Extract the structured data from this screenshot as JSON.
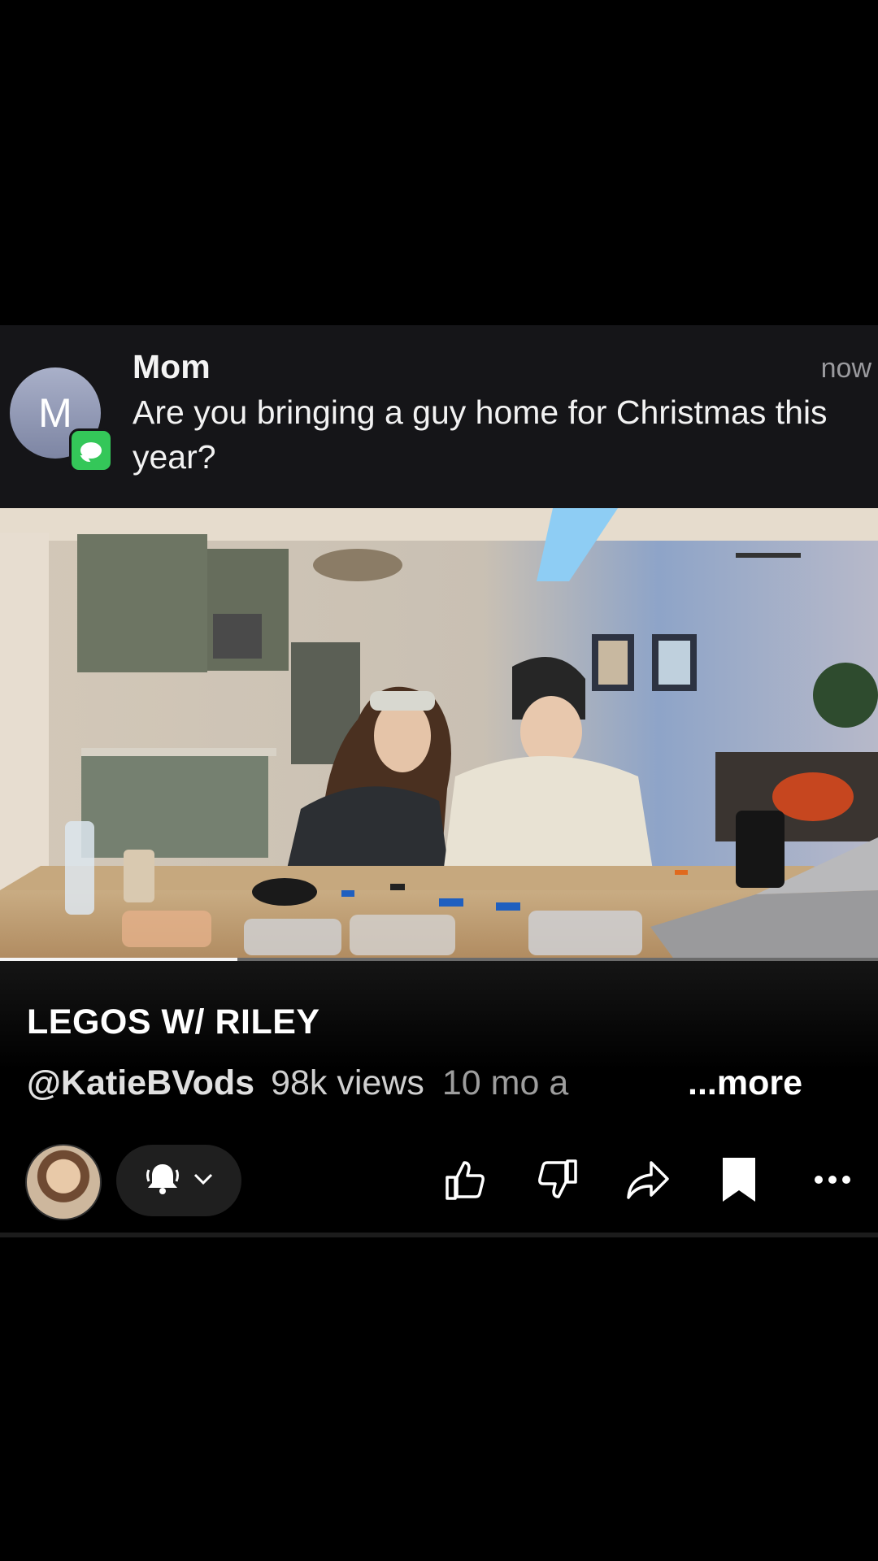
{
  "notification": {
    "avatar_initial": "M",
    "sender": "Mom",
    "time": "now",
    "message": "Are you bringing a guy home for Christmas this year?",
    "app_icon": "messages-icon"
  },
  "video": {
    "scene": "two-people-building-lego-at-kitchen-table",
    "progress": 0.27
  },
  "info": {
    "title": "LEGOS W/ RILEY",
    "handle": "@KatieBVods",
    "views": "98k views",
    "age_visible": "10 mo a",
    "more_label": "...more"
  },
  "actions": {
    "channel_avatar": "channel-avatar",
    "subscribe_icon": "bell-icon",
    "like_icon": "thumbs-up-icon",
    "dislike_icon": "thumbs-down-icon",
    "share_icon": "share-icon",
    "save_icon": "bookmark-icon",
    "more_icon": "more-horizontal-icon"
  }
}
